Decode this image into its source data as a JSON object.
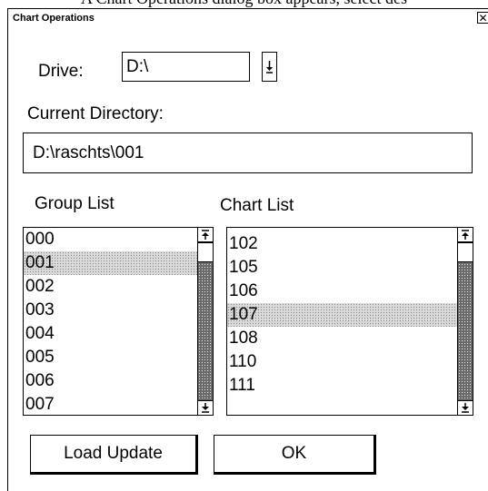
{
  "clipped_text": "A Chart Operations dialog box appears, select des",
  "dialog": {
    "title": "Chart Operations",
    "close_glyph": "✕"
  },
  "drive": {
    "label": "Drive:",
    "value": "D:\\",
    "dropdown_icon": "arrow-down-icon"
  },
  "current_directory": {
    "label": "Current Directory:",
    "value": "D:\\raschts\\001"
  },
  "group_list": {
    "label": "Group List",
    "items": [
      "000",
      "001",
      "002",
      "003",
      "004",
      "005",
      "006",
      "007"
    ],
    "selected": "001"
  },
  "chart_list": {
    "label": "Chart List",
    "items": [
      "102",
      "105",
      "106",
      "107",
      "108",
      "110",
      "111"
    ],
    "selected": "107"
  },
  "buttons": {
    "load_update": "Load Update",
    "ok": "OK"
  }
}
